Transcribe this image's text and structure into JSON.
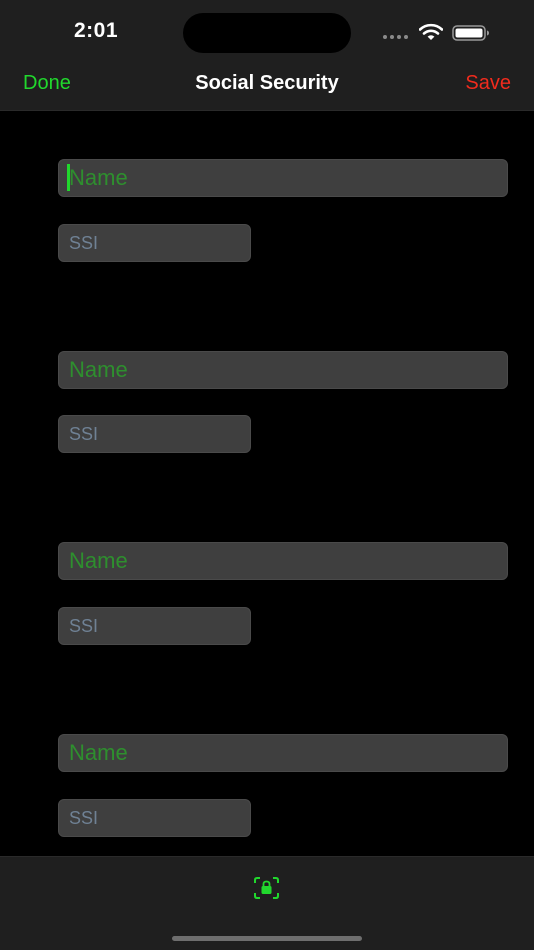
{
  "status_bar": {
    "time": "2:01"
  },
  "nav": {
    "done_label": "Done",
    "title": "Social Security",
    "save_label": "Save"
  },
  "entries": [
    {
      "name_placeholder": "Name",
      "ssi_placeholder": "SSI",
      "name_value": "",
      "ssi_value": ""
    },
    {
      "name_placeholder": "Name",
      "ssi_placeholder": "SSI",
      "name_value": "",
      "ssi_value": ""
    },
    {
      "name_placeholder": "Name",
      "ssi_placeholder": "SSI",
      "name_value": "",
      "ssi_value": ""
    },
    {
      "name_placeholder": "Name",
      "ssi_placeholder": "SSI",
      "name_value": "",
      "ssi_value": ""
    }
  ],
  "tab_bar": {
    "icon": "lock-icon"
  },
  "colors": {
    "accent_green": "#21d82d",
    "save_red": "#f02b1d",
    "name_placeholder_green": "#2e8f2e",
    "ssi_placeholder_gray": "#6f8194",
    "field_background": "#3f3f3f",
    "bar_background": "#1f1f1f"
  }
}
